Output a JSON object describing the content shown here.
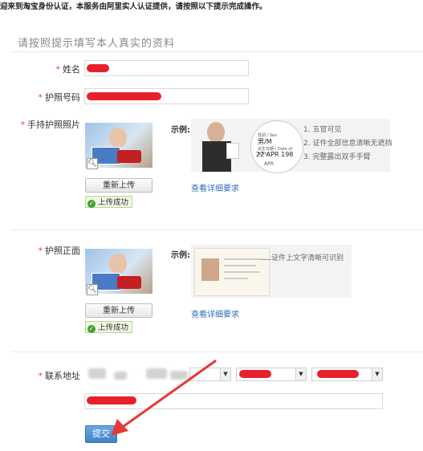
{
  "notice": "迎来到淘宝身份认证，本服务由阿里实人认证提供，请按照以下提示完成操作。",
  "section_title": "请按照提示填写本人真实的资料",
  "required_mark": "*",
  "fields": {
    "name_label": "姓名",
    "passport_no_label": "护照号码",
    "handheld_label": "手持护照照片",
    "passport_front_label": "护照正面",
    "address_label": "联系地址"
  },
  "upload": {
    "reupload_label": "重新上传",
    "success_label": "上传成功",
    "example_label": "示例:",
    "detail_link": "查看详细要求",
    "zoom_icon": "magnifier-icon",
    "check_icon": "check-circle-icon"
  },
  "handheld_example": {
    "tips": [
      "1. 五官可见",
      "2. 证件全部信息清晰无遮挡",
      "3. 完整露出双手手臂"
    ],
    "passport_text_lines": [
      "性别 / Sex",
      "男/M",
      "出生日期 / Date of birth",
      "22 APR 198",
      "APR"
    ]
  },
  "front_example": {
    "tip": "证件上文字清晰可识别"
  },
  "submit_label": "提交",
  "colors": {
    "required": "#e8482c",
    "redaction": "#e8202b",
    "link": "#2e6fb4",
    "submit": "#4a8fd3",
    "annotation_arrow": "#e53935"
  }
}
